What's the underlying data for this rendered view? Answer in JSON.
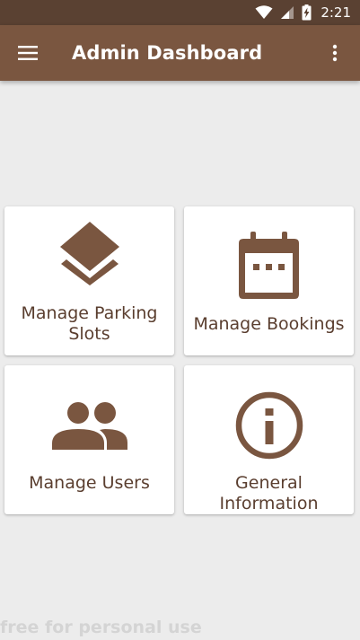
{
  "status_bar": {
    "time": "2:21"
  },
  "app_bar": {
    "title": "Admin Dashboard"
  },
  "cards": [
    {
      "label": "Manage Parking Slots",
      "icon": "layers-icon"
    },
    {
      "label": "Manage Bookings",
      "icon": "calendar-icon"
    },
    {
      "label": "Manage Users",
      "icon": "users-icon"
    },
    {
      "label": "General Information",
      "icon": "info-icon"
    }
  ],
  "watermark": "free for personal use",
  "colors": {
    "status_bar": "#5a4132",
    "app_bar": "#7a5640",
    "icon": "#7a5640",
    "label": "#5a3e2f",
    "background": "#ececec"
  }
}
